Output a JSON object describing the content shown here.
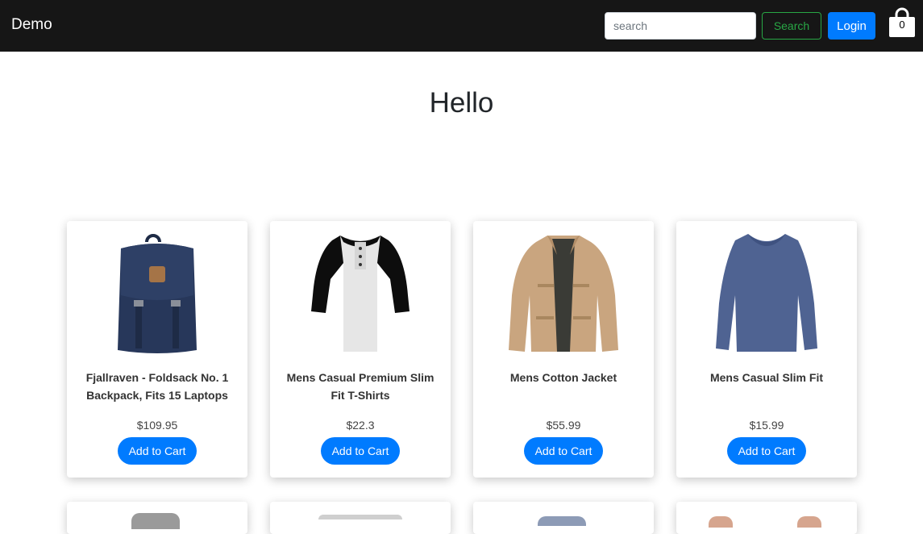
{
  "navbar": {
    "brand": "Demo",
    "search_placeholder": "search",
    "search_label": "Search",
    "login_label": "Login",
    "cart_count": "0"
  },
  "hero": {
    "title": "Hello"
  },
  "products": [
    {
      "title": "Fjallraven - Foldsack No. 1 Backpack, Fits 15 Laptops",
      "price": "$109.95",
      "button": "Add to Cart",
      "image": "backpack-image"
    },
    {
      "title": "Mens Casual Premium Slim Fit T-Shirts",
      "price": "$22.3",
      "button": "Add to Cart",
      "image": "raglan-tshirt-image"
    },
    {
      "title": "Mens Cotton Jacket",
      "price": "$55.99",
      "button": "Add to Cart",
      "image": "cotton-jacket-image"
    },
    {
      "title": "Mens Casual Slim Fit",
      "price": "$15.99",
      "button": "Add to Cart",
      "image": "longsleeve-shirt-image"
    }
  ],
  "colors": {
    "navbar_bg": "#161616",
    "primary": "#007bff",
    "success": "#28a745"
  }
}
